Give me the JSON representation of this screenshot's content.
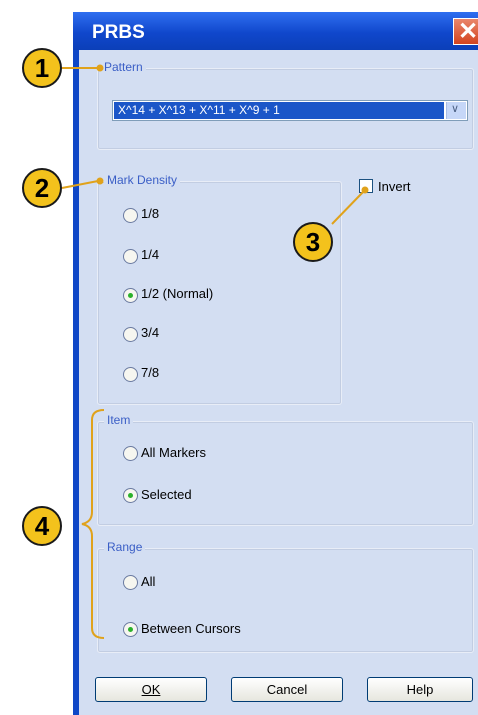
{
  "dialog": {
    "title": "PRBS"
  },
  "pattern": {
    "legend": "Pattern",
    "selected": "X^14 + X^13 + X^11 + X^9 + 1"
  },
  "mark_density": {
    "legend": "Mark Density",
    "options": [
      {
        "label": "1/8",
        "checked": false
      },
      {
        "label": "1/4",
        "checked": false
      },
      {
        "label": "1/2 (Normal)",
        "checked": true
      },
      {
        "label": "3/4",
        "checked": false
      },
      {
        "label": "7/8",
        "checked": false
      }
    ]
  },
  "invert": {
    "label": "Invert",
    "checked": false
  },
  "item": {
    "legend": "Item",
    "options": [
      {
        "label": "All Markers",
        "checked": false
      },
      {
        "label": "Selected",
        "checked": true
      }
    ]
  },
  "range": {
    "legend": "Range",
    "options": [
      {
        "label": "All",
        "checked": false
      },
      {
        "label": "Between Cursors",
        "checked": true
      }
    ]
  },
  "buttons": {
    "ok": "OK",
    "cancel": "Cancel",
    "help": "Help"
  },
  "callouts": [
    "1",
    "2",
    "3",
    "4"
  ],
  "colors": {
    "callout_fill": "#f3c21c",
    "leader": "#e0a21b",
    "titlebar": "#0f47c7",
    "panel": "#d3def2"
  }
}
